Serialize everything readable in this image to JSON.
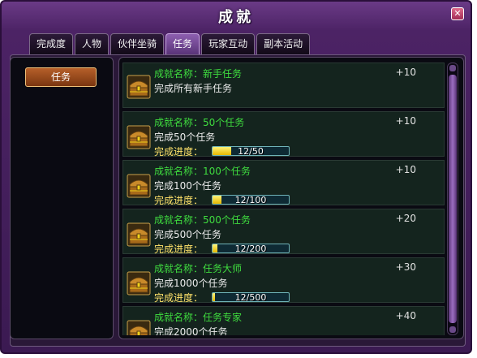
{
  "window": {
    "title": "成就",
    "close_glyph": "✕"
  },
  "tabs": [
    {
      "label": "完成度",
      "active": false
    },
    {
      "label": "人物",
      "active": false
    },
    {
      "label": "伙伴坐骑",
      "active": false
    },
    {
      "label": "任务",
      "active": true
    },
    {
      "label": "玩家互动",
      "active": false
    },
    {
      "label": "副本活动",
      "active": false
    }
  ],
  "sidebar": {
    "selected_category": "任务"
  },
  "achievements": [
    {
      "name_prefix": "成就名称：",
      "name": "新手任务",
      "points": "+10",
      "desc": "完成所有新手任务",
      "has_progress": false
    },
    {
      "name_prefix": "成就名称：",
      "name": "50个任务",
      "points": "+10",
      "desc": "完成50个任务",
      "has_progress": true,
      "progress_label": "完成进度：",
      "progress_text": "12/50",
      "progress_fraction": 0.24
    },
    {
      "name_prefix": "成就名称：",
      "name": "100个任务",
      "points": "+10",
      "desc": "完成100个任务",
      "has_progress": true,
      "progress_label": "完成进度：",
      "progress_text": "12/100",
      "progress_fraction": 0.12
    },
    {
      "name_prefix": "成就名称：",
      "name": "500个任务",
      "points": "+20",
      "desc": "完成500个任务",
      "has_progress": true,
      "progress_label": "完成进度：",
      "progress_text": "12/200",
      "progress_fraction": 0.06
    },
    {
      "name_prefix": "成就名称：",
      "name": "任务大师",
      "points": "+30",
      "desc": "完成1000个任务",
      "has_progress": true,
      "progress_label": "完成进度：",
      "progress_text": "12/500",
      "progress_fraction": 0.024
    },
    {
      "name_prefix": "成就名称：",
      "name": "任务专家",
      "points": "+40",
      "desc": "完成2000个任务",
      "has_progress": false
    }
  ],
  "icons": {
    "item_icon": "treasure-chest-icon"
  },
  "colors": {
    "name_green": "#3fdc3f",
    "progress_yellow": "#ffe26a",
    "bar_fill": "#f2d21a"
  }
}
